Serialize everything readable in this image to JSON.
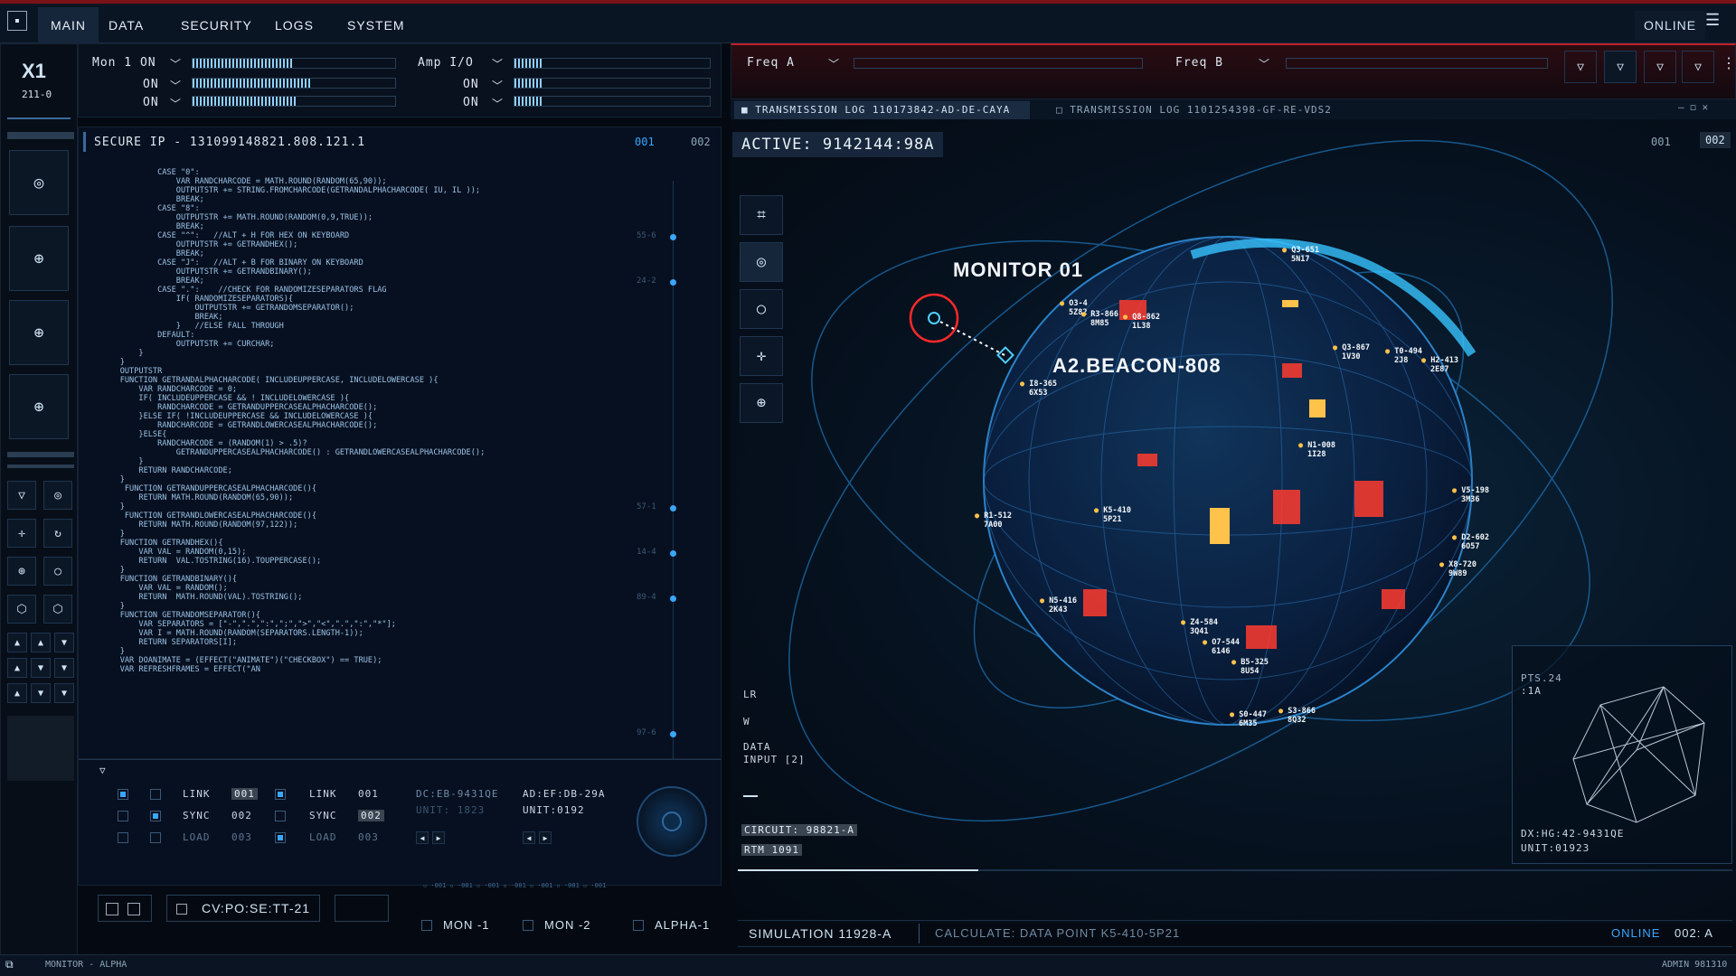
{
  "topbar": {
    "tabs": [
      "MAIN",
      "DATA",
      "SECURITY",
      "LOGS",
      "SYSTEM"
    ],
    "status": "ONLINE"
  },
  "device": {
    "name": "X1",
    "code": "211-0"
  },
  "meters": {
    "mon1": {
      "label": "Mon 1 ON",
      "rows": [
        "ON",
        "ON"
      ],
      "levels": [
        0.5,
        0.58,
        0.52
      ]
    },
    "amp": {
      "label": "Amp I/O",
      "rows": [
        "ON",
        "ON"
      ],
      "levels": [
        0.15,
        0.15,
        0.15
      ]
    },
    "freq_a": "Freq A",
    "freq_b": "Freq B"
  },
  "secure_ip": "SECURE IP - 131099148821.808.121.1",
  "code_tabs": [
    "001",
    "002"
  ],
  "code_lines": [
    "            CASE \"0\":",
    "                VAR RANDCHARCODE = MATH.ROUND(RANDOM(65,90));",
    "                OUTPUTSTR += STRING.FROMCHARCODE(GETRANDALPHACHARCODE( IU, IL ));",
    "                BREAK;",
    "            CASE \"8\":",
    "                OUTPUTSTR += MATH.ROUND(RANDOM(0,9,TRUE));",
    "                BREAK;",
    "            CASE \"^\":   //ALT + H FOR HEX ON KEYBOARD",
    "                OUTPUTSTR += GETRANDHEX();",
    "                BREAK;",
    "            CASE \"J\":   //ALT + B FOR BINARY ON KEYBOARD",
    "                OUTPUTSTR += GETRANDBINARY();",
    "                BREAK;",
    "            CASE \".\":    //CHECK FOR RANDOMIZESEPARATORS FLAG",
    "                IF( RANDOMIZESEPARATORS){",
    "                    OUTPUTSTR += GETRANDOMSEPARATOR();",
    "                    BREAK;",
    "                }   //ELSE FALL THROUGH",
    "            DEFAULT:",
    "                OUTPUTSTR += CURCHAR;",
    "        }",
    "    }",
    "    OUTPUTSTR",
    "",
    "    FUNCTION GETRANDALPHACHARCODE( INCLUDEUPPERCASE, INCLUDELOWERCASE ){",
    "        VAR RANDCHARCODE = 0;",
    "        IF( INCLUDEUPPERCASE && ! INCLUDELOWERCASE ){",
    "            RANDCHARCODE = GETRANDUPPERCASEALPHACHARCODE();",
    "        }ELSE IF( !INCLUDEUPPERCASE && INCLUDELOWERCASE ){",
    "            RANDCHARCODE = GETRANDLOWERCASEALPHACHARCODE();",
    "        }ELSE{",
    "            RANDCHARCODE = (RANDOM(1) > .5)?",
    "                GETRANDUPPERCASEALPHACHARCODE() : GETRANDLOWERCASEALPHACHARCODE();",
    "        }",
    "        RETURN RANDCHARCODE;",
    "    }",
    "",
    "     FUNCTION GETRANDUPPERCASEALPHACHARCODE(){",
    "        RETURN MATH.ROUND(RANDOM(65,90));",
    "    }",
    "     FUNCTION GETRANDLOWERCASEALPHACHARCODE(){",
    "        RETURN MATH.ROUND(RANDOM(97,122));",
    "    }",
    "",
    "    FUNCTION GETRANDHEX(){",
    "        VAR VAL = RANDOM(0,15);",
    "        RETURN  VAL.TOSTRING(16).TOUPPERCASE();",
    "    }",
    "",
    "    FUNCTION GETRANDBINARY(){",
    "        VAR VAL = RANDOM();",
    "        RETURN  MATH.ROUND(VAL).TOSTRING();",
    "    }",
    "    FUNCTION GETRANDOMSEPARATOR(){",
    "        VAR SEPARATORS = [\"-\",\".\",\":\",\";\",\">\",\"<\",\".\",\":\",\"*\"];",
    "        VAR I = MATH.ROUND(RANDOM(SEPARATORS.LENGTH-1));",
    "        RETURN SEPARATORS[I];",
    "    }",
    "",
    "    VAR DOANIMATE = (EFFECT(\"ANIMATE\")(\"CHECKBOX\") == TRUE);",
    "    VAR REFRESHFRAMES = EFFECT(\"AN"
  ],
  "timeline_ticks": [
    "55-6",
    "24-2",
    "57-1",
    "14-4",
    "89-4",
    "97-6"
  ],
  "controls": {
    "col1": [
      {
        "label": "LINK",
        "num": "001"
      },
      {
        "label": "SYNC",
        "num": "002"
      },
      {
        "label": "LOAD",
        "num": "003"
      }
    ],
    "col2": [
      {
        "label": "LINK",
        "num": "001"
      },
      {
        "label": "SYNC",
        "num": "002"
      },
      {
        "label": "LOAD",
        "num": "003"
      }
    ],
    "dc": "DC:EB-9431QE",
    "dc_unit": "UNIT: 1823",
    "ad": "AD:EF:DB-29A",
    "ad_unit": "UNIT:0192"
  },
  "bottom_left": {
    "cv": "CV:PO:SE:TT-21",
    "mons": [
      "MON -1",
      "MON -2",
      "ALPHA-1"
    ]
  },
  "footer": {
    "left": "MONITOR - ALPHA",
    "right": "ADMIN 981310"
  },
  "log_tabs": [
    "TRANSMISSION LOG 110173842-AD-DE-CAYA",
    "TRANSMISSION LOG 1101254398-GF-RE-VDS2"
  ],
  "viz": {
    "active": "ACTIVE: 9142144:98A",
    "tabs": [
      "001",
      "002"
    ],
    "monitor": "MONITOR 01",
    "beacon": "A2.BEACON-808",
    "side_labels": [
      "LR",
      "W",
      "DATA",
      "INPUT [2]"
    ],
    "circuit": "CIRCUIT: 98821-A",
    "rtm": "RTM 1091",
    "pts": "PTS.24",
    "pts2": ":1A",
    "dx": "DX:HG:42-9431QE",
    "unit": "UNIT:01923",
    "points": [
      {
        "a": "Q3-651",
        "b": "5N17"
      },
      {
        "a": "O3-4",
        "b": "5Z82"
      },
      {
        "a": "R3-866",
        "b": "8M85"
      },
      {
        "a": "Q8-862",
        "b": "1L38"
      },
      {
        "a": "Q3-867",
        "b": "1V30"
      },
      {
        "a": "T0-494",
        "b": "2J8"
      },
      {
        "a": "H2-413",
        "b": "2E87"
      },
      {
        "a": "I8-365",
        "b": "6X53"
      },
      {
        "a": "N1-008",
        "b": "1I28"
      },
      {
        "a": "V5-198",
        "b": "3M36"
      },
      {
        "a": "R1-512",
        "b": "7A00"
      },
      {
        "a": "K5-410",
        "b": "5P21"
      },
      {
        "a": "D2-602",
        "b": "6O57"
      },
      {
        "a": "X8-720",
        "b": "9W89"
      },
      {
        "a": "N5-416",
        "b": "2K43"
      },
      {
        "a": "Z4-584",
        "b": "3Q41"
      },
      {
        "a": "O7-544",
        "b": "6146"
      },
      {
        "a": "B5-325",
        "b": "8U54"
      },
      {
        "a": "S0-447",
        "b": "6M35"
      },
      {
        "a": "S3-866",
        "b": "8Q32"
      }
    ]
  },
  "status_bar": {
    "sim": "SIMULATION 11928-A",
    "calc": "CALCULATE: DATA POINT K5-410-5P21",
    "online": "ONLINE",
    "code": "002: A"
  }
}
